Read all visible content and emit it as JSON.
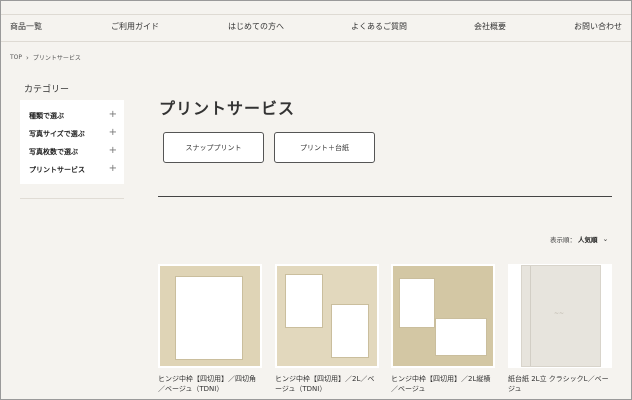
{
  "nav": {
    "items": [
      {
        "label": "商品一覧"
      },
      {
        "label": "ご利用ガイド"
      },
      {
        "label": "はじめての方へ"
      },
      {
        "label": "よくあるご質問"
      },
      {
        "label": "会社概要"
      },
      {
        "label": "お問い合わせ"
      }
    ]
  },
  "breadcrumb": {
    "home": "TOP",
    "separator": "›",
    "current": "プリントサービス"
  },
  "sidebar": {
    "title": "カテゴリー",
    "items": [
      {
        "label": "種類で選ぶ",
        "icon": "plus-icon"
      },
      {
        "label": "写真サイズで選ぶ",
        "icon": "plus-icon"
      },
      {
        "label": "写真枚数で選ぶ",
        "icon": "plus-icon"
      },
      {
        "label": "プリントサービス",
        "icon": "plus-icon"
      }
    ]
  },
  "main": {
    "title": "プリントサービス",
    "buttons": [
      {
        "label": "スナッププリント"
      },
      {
        "label": "プリント＋台紙"
      }
    ],
    "sort": {
      "prefix": "表示順：",
      "value": "人気順",
      "icon": "chevron-down-icon"
    }
  },
  "products": [
    {
      "title": "ヒンジ中枠【四切用】／四切角／ベージュ（TDNI）",
      "image": "mat-single-opening"
    },
    {
      "title": "ヒンジ中枠【四切用】／2L／ベージュ（TDNI）",
      "image": "mat-two-openings-diagonal"
    },
    {
      "title": "ヒンジ中枠【四切用】／2L縦横／ベージュ",
      "image": "mat-portrait-landscape-openings"
    },
    {
      "title": "紙台紙 2L立 クラシックL／ベージュ",
      "image": "album-cover"
    }
  ],
  "colors": {
    "background": "#f5f3ef",
    "mat": "#dfd4b6",
    "text": "#333333",
    "divider": "#444444"
  }
}
